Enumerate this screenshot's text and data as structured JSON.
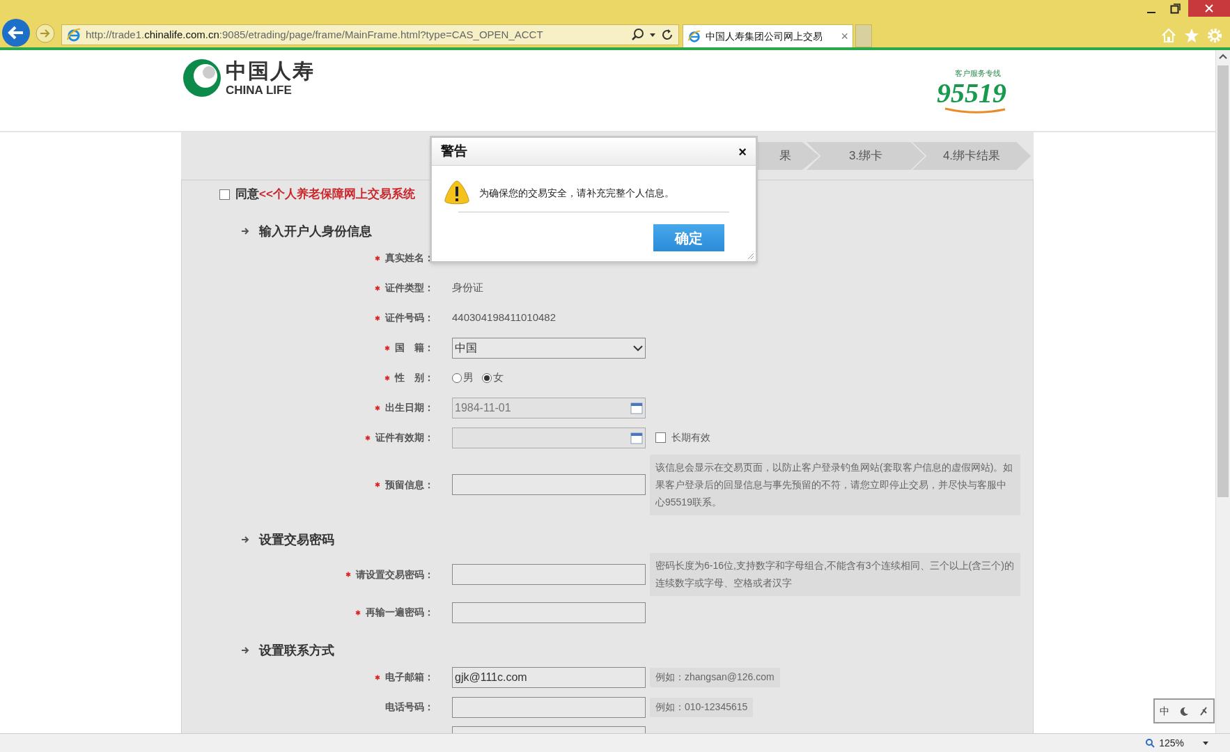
{
  "browser": {
    "address": {
      "before": "http://trade1.",
      "domain": "chinalife.com.cn",
      "after": ":9085/etrading/page/frame/MainFrame.html?type=CAS_OPEN_ACCT"
    },
    "tab": {
      "title": "中国人寿集团公司网上交易",
      "close": "×"
    }
  },
  "header": {
    "logo_cn": "中国人寿",
    "logo_en": "CHINA LIFE",
    "hotline_caption": "客户服务专线",
    "hotline": "95519"
  },
  "steps": [
    {
      "label": "果",
      "selected": false
    },
    {
      "label": "3.绑卡",
      "selected": false
    },
    {
      "label": "4.绑卡结果",
      "selected": false
    }
  ],
  "agree": {
    "checked": false,
    "prefix": "同意",
    "link": "<<个人养老保障网上交易系统"
  },
  "sections": [
    {
      "title": "输入开户人身份信息",
      "fields": [
        {
          "kind": "label_only",
          "label": "真实姓名：",
          "required": true
        },
        {
          "kind": "text",
          "label": "证件类型：",
          "required": true,
          "value": "身份证"
        },
        {
          "kind": "text",
          "label": "证件号码：",
          "required": true,
          "value": "440304198411010482"
        },
        {
          "kind": "select",
          "label": "国　籍：",
          "required": true,
          "value": "中国"
        },
        {
          "kind": "radio",
          "label": "性　别：",
          "required": true,
          "options": [
            {
              "label": "男",
              "selected": false
            },
            {
              "label": "女",
              "selected": true
            }
          ]
        },
        {
          "kind": "date",
          "label": "出生日期：",
          "required": true,
          "value": "1984-11-01"
        },
        {
          "kind": "date",
          "label": "证件有效期：",
          "required": true,
          "check": {
            "label": "长期有效",
            "checked": false
          }
        },
        {
          "kind": "input",
          "label": "预留信息：",
          "required": true,
          "note": "该信息会显示在交易页面，以防止客户登录钓鱼网站(套取客户信息的虚假网站)。如果客户登录后的回显信息与事先预留的不符，请您立即停止交易，并尽快与客服中心95519联系。"
        }
      ]
    },
    {
      "title": "设置交易密码",
      "fields": [
        {
          "kind": "input",
          "label": "请设置交易密码：",
          "required": true,
          "note": "密码长度为6-16位,支持数字和字母组合,不能含有3个连续相同、三个以上(含三个)的连续数字或字母、空格或者汉字"
        },
        {
          "kind": "input",
          "label": "再输一遍密码：",
          "required": true
        }
      ]
    },
    {
      "title": "设置联系方式",
      "fields": [
        {
          "kind": "input",
          "label": "电子邮箱：",
          "required": true,
          "value": "gjk@111c.com",
          "example": "例如：zhangsan@126.com"
        },
        {
          "kind": "input",
          "label": "电话号码：",
          "required": false,
          "example": "例如：010-12345615"
        },
        {
          "kind": "cut"
        }
      ]
    }
  ],
  "dialog": {
    "title": "警告",
    "close": "×",
    "message": "为确保您的交易安全，请补充完整个人信息。",
    "button": "确定"
  },
  "ime": {
    "mode": "中"
  },
  "status_bar": {
    "zoom": "125%"
  }
}
